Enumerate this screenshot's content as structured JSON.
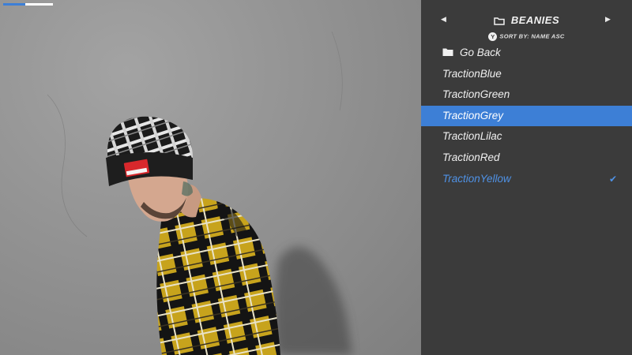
{
  "progress": {
    "fraction": 0.45
  },
  "menu": {
    "title": "BEANIES",
    "sort_button": "Y",
    "sort_label": "SORT BY: NAME ASC",
    "go_back": "Go Back",
    "items": [
      {
        "label": "TractionBlue",
        "state": "normal"
      },
      {
        "label": "TractionGreen",
        "state": "normal"
      },
      {
        "label": "TractionGrey",
        "state": "selected"
      },
      {
        "label": "TractionLilac",
        "state": "normal"
      },
      {
        "label": "TractionRed",
        "state": "normal"
      },
      {
        "label": "TractionYellow",
        "state": "equipped"
      }
    ],
    "equipped_mark": "✔"
  },
  "colors": {
    "panel_bg": "#3b3b3b",
    "accent": "#3d7fd6",
    "equipped_text": "#4f92e6",
    "wall": "#8d8d8d"
  },
  "icons": {
    "nav_left": "triangle-left-icon",
    "nav_right": "triangle-right-icon",
    "category": "folder-icon",
    "go_back": "folder-icon",
    "equipped": "checkmark-icon"
  }
}
